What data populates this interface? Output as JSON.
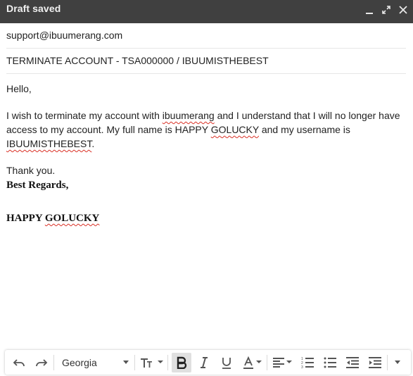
{
  "header": {
    "title": "Draft saved",
    "minimize_icon": "minimize-icon",
    "expand_icon": "expand-icon",
    "close_icon": "close-icon"
  },
  "fields": {
    "to": "support@ibuumerang.com",
    "subject": "TERMINATE ACCOUNT - TSA000000 / IBUUMISTHEBEST"
  },
  "body": {
    "greeting": "Hello,",
    "p1_a": "I wish to terminate my account with ",
    "p1_brand": "ibuumerang",
    "p1_b": " and I understand that I will no longer have access to my account. My full name is HAPPY ",
    "p1_lastname": "GOLUCKY",
    "p1_c": " and my username is ",
    "p1_username": "IBUUMISTHEBEST",
    "p1_d": ".",
    "thanks": "Thank you.",
    "regards": "Best Regards,",
    "sig_first": "HAPPY ",
    "sig_last": "GOLUCKY"
  },
  "toolbar": {
    "font": "Georgia",
    "icons": [
      "undo-icon",
      "redo-icon",
      "font-size-icon",
      "bold-icon",
      "italic-icon",
      "underline-icon",
      "text-color-icon",
      "align-icon",
      "numbered-list-icon",
      "bulleted-list-icon",
      "indent-less-icon",
      "indent-more-icon",
      "more-options-icon"
    ],
    "bold_active": true
  }
}
